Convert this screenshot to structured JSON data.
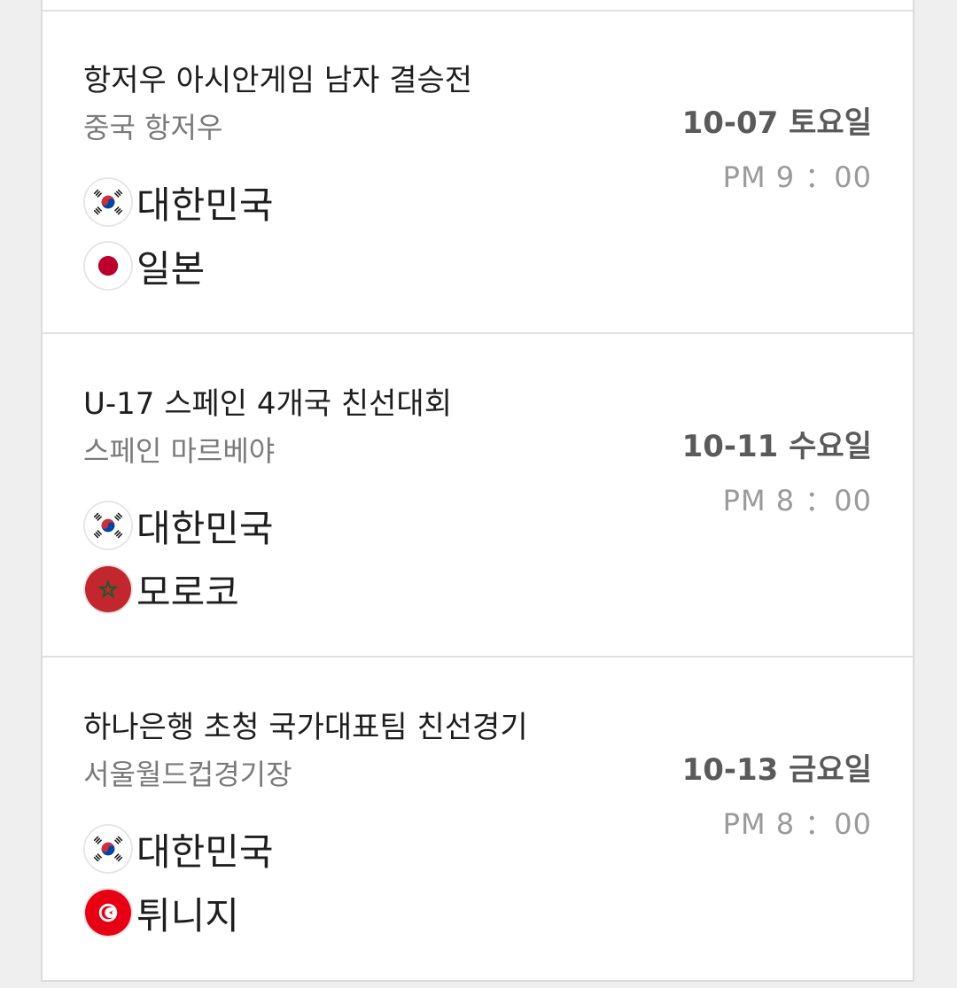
{
  "matches": [
    {
      "title": "항저우 아시안게임 남자 결승전",
      "venue": "중국 항저우",
      "date": "10-07 토요일",
      "time": "PM 9 ：00",
      "teams": [
        {
          "name": "대한민국",
          "flag": "korea-flag-icon"
        },
        {
          "name": "일본",
          "flag": "japan-flag-icon"
        }
      ]
    },
    {
      "title": "U-17 스페인 4개국 친선대회",
      "venue": "스페인 마르베야",
      "date": "10-11 수요일",
      "time": "PM 8 ：00",
      "teams": [
        {
          "name": "대한민국",
          "flag": "korea-flag-icon"
        },
        {
          "name": "모로코",
          "flag": "morocco-flag-icon"
        }
      ]
    },
    {
      "title": "하나은행 초청 국가대표팀 친선경기",
      "venue": "서울월드컵경기장",
      "date": "10-13 금요일",
      "time": "PM 8 ：00",
      "teams": [
        {
          "name": "대한민국",
          "flag": "korea-flag-icon"
        },
        {
          "name": "튀니지",
          "flag": "tunisia-flag-icon"
        }
      ]
    }
  ],
  "colors": {
    "background": "#efefef",
    "card": "#ffffff",
    "divider": "#e0e0e0",
    "title_text": "#1e1e1e",
    "venue_text": "#7a7a7a",
    "date_text": "#5a5a5a",
    "time_text": "#9a9a9a"
  }
}
